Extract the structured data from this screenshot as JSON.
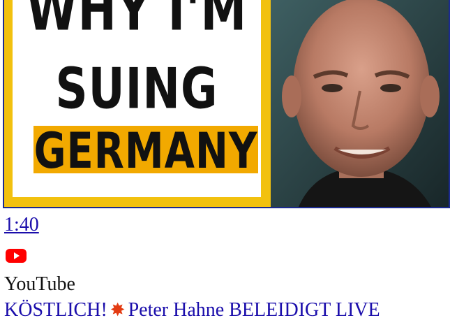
{
  "thumbnail": {
    "headline_line1": "WHY I'M",
    "headline_line2": "SUING",
    "headline_line3": "GERMANY",
    "panel_color": "#f2c10f",
    "band_color": "#f2a900",
    "border_color": "#1b2a8f"
  },
  "video": {
    "duration": "1:40",
    "source_icon": "youtube-play-icon",
    "source_name": "YouTube",
    "title_prefix": "KÖSTLICH!",
    "title_emoji": "collision-icon",
    "title_rest": "Peter Hahne BELEIDIGT LIVE"
  },
  "colors": {
    "link": "#1a0dab",
    "youtube_red": "#ff0000"
  }
}
